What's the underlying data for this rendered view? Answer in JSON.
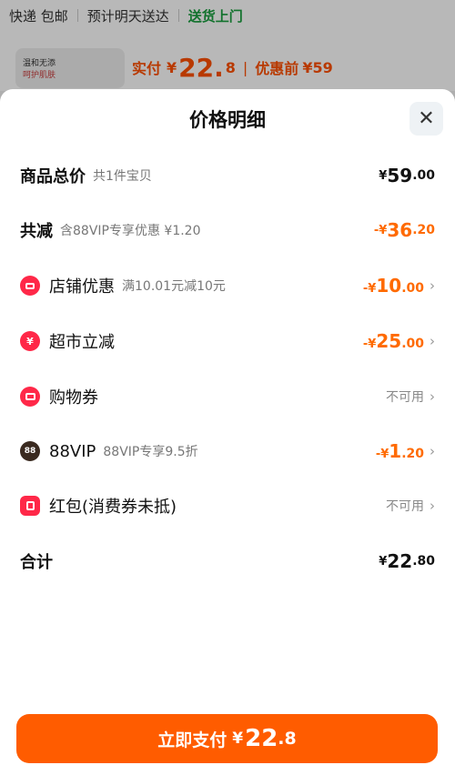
{
  "background": {
    "shipping": [
      "快递 包邮",
      "预计明天送达",
      "送货上门"
    ],
    "thumb_lines": [
      "温和无添",
      "呵护肌肤"
    ],
    "pay_prefix": "实付",
    "currency": "¥",
    "pay_int": "22.",
    "pay_dec": "8",
    "orig_label": "优惠前",
    "orig_price": "¥59"
  },
  "sheet": {
    "title": "价格明细",
    "close_label": "✕"
  },
  "rows": {
    "total": {
      "label": "商品总价",
      "sub": "共1件宝贝",
      "yen": "¥",
      "int": "59",
      "dec": ".00"
    },
    "reduce": {
      "label": "共减",
      "sub": "含88VIP专享优惠 ¥1.20",
      "yen": "-¥",
      "int": "36",
      "dec": ".20"
    },
    "shop": {
      "label": "店铺优惠",
      "sub": "满10.01元减10元",
      "yen": "-¥",
      "int": "10",
      "dec": ".00"
    },
    "market": {
      "label": "超市立减",
      "yen": "-¥",
      "int": "25",
      "dec": ".00"
    },
    "coupon": {
      "label": "购物券",
      "status": "不可用"
    },
    "vip": {
      "icon_text": "88",
      "label": "88VIP",
      "sub": "88VIP专享9.5折",
      "yen": "-¥",
      "int": "1",
      "dec": ".20"
    },
    "redpack": {
      "label": "红包(消费券未抵)",
      "status": "不可用"
    },
    "sum": {
      "label": "合计",
      "yen": "¥",
      "int": "22",
      "dec": ".80"
    }
  },
  "pay_button": {
    "label": "立即支付",
    "yen": "¥",
    "int": "22",
    "dec": ".8"
  },
  "chevron": "›",
  "colors": {
    "accent": "#ff5c00",
    "discount": "#ff6a00",
    "icon_red": "#ff2848",
    "green": "#1a9e3f"
  }
}
